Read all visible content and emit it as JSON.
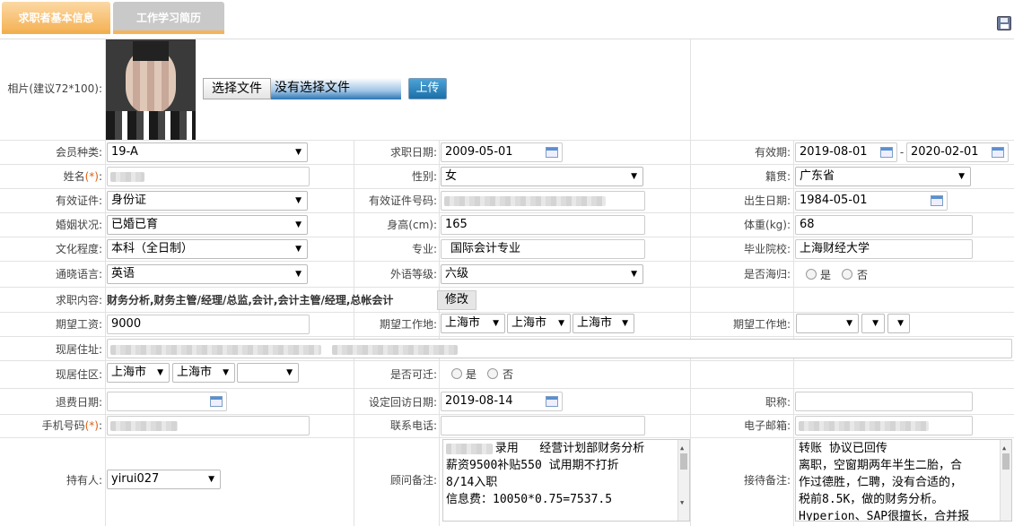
{
  "tabs": {
    "basic": "求职者基本信息",
    "work": "工作学习简历"
  },
  "photo": {
    "label": "相片(建议72*100):",
    "choose_btn": "选择文件",
    "no_file": "没有选择文件",
    "upload_btn": "上传"
  },
  "fields": {
    "member_type": {
      "label": "会员种类:",
      "value": "19-A"
    },
    "apply_date": {
      "label": "求职日期:",
      "value": "2009-05-01"
    },
    "valid_period": {
      "label": "有效期:",
      "from": "2019-08-01",
      "sep": "-",
      "to": "2020-02-01"
    },
    "name": {
      "label": "姓名",
      "req": "(*)",
      "colon": ":"
    },
    "gender": {
      "label": "性别:",
      "value": "女"
    },
    "origin": {
      "label": "籍贯:",
      "value": "广东省"
    },
    "id_type": {
      "label": "有效证件:",
      "value": "身份证"
    },
    "id_no": {
      "label": "有效证件号码:"
    },
    "birth": {
      "label": "出生日期:",
      "value": "1984-05-01"
    },
    "marital": {
      "label": "婚姻状况:",
      "value": "已婚已育"
    },
    "height": {
      "label": "身高(cm):",
      "value": "165"
    },
    "weight": {
      "label": "体重(kg):",
      "value": "68"
    },
    "education": {
      "label": "文化程度:",
      "value": "本科（全日制）"
    },
    "major": {
      "label": "专业:",
      "value": "国际会计专业"
    },
    "school": {
      "label": "毕业院校:",
      "value": "上海财经大学"
    },
    "language": {
      "label": "通晓语言:",
      "value": "英语"
    },
    "lang_level": {
      "label": "外语等级:",
      "value": "六级"
    },
    "returnee": {
      "label": "是否海归:",
      "yes": "是",
      "no": "否"
    },
    "job_content": {
      "label": "求职内容:",
      "value": "财务分析,财务主管/经理/总监,会计,会计主管/经理,总帐会计",
      "modify": "修改"
    },
    "salary": {
      "label": "期望工资:",
      "value": "9000"
    },
    "work_place1": {
      "label": "期望工作地:",
      "v1": "上海市",
      "v2": "上海市",
      "v3": "上海市"
    },
    "work_place2": {
      "label": "期望工作地:"
    },
    "address": {
      "label": "现居住址:"
    },
    "district": {
      "label": "现居住区:",
      "v1": "上海市",
      "v2": "上海市"
    },
    "relocate": {
      "label": "是否可迁:",
      "yes": "是",
      "no": "否"
    },
    "refund_date": {
      "label": "退费日期:"
    },
    "visit_date": {
      "label": "设定回访日期:",
      "value": "2019-08-14"
    },
    "title": {
      "label": "职称:"
    },
    "mobile": {
      "label": "手机号码",
      "req": "(*)",
      "colon": ":"
    },
    "phone": {
      "label": "联系电话:"
    },
    "email": {
      "label": "电子邮箱:"
    },
    "holder": {
      "label": "持有人:",
      "value": "yirui027"
    },
    "consultant_note": {
      "label": "顾问备注:",
      "value": "       录用   经营计划部财务分析\n薪资9500补贴550 试用期不打折\n8/14入职\n信息费：10050*0.75=7537.5"
    },
    "reception_note": {
      "label": "接待备注:",
      "value": "转账 协议已回传\n离职，空窗期两年半生二胎，合\n作过德胜，仁聘，没有合适的，\n税前8.5K，做的财务分析。\nHyperion、SAP很擅长，合并报"
    }
  }
}
